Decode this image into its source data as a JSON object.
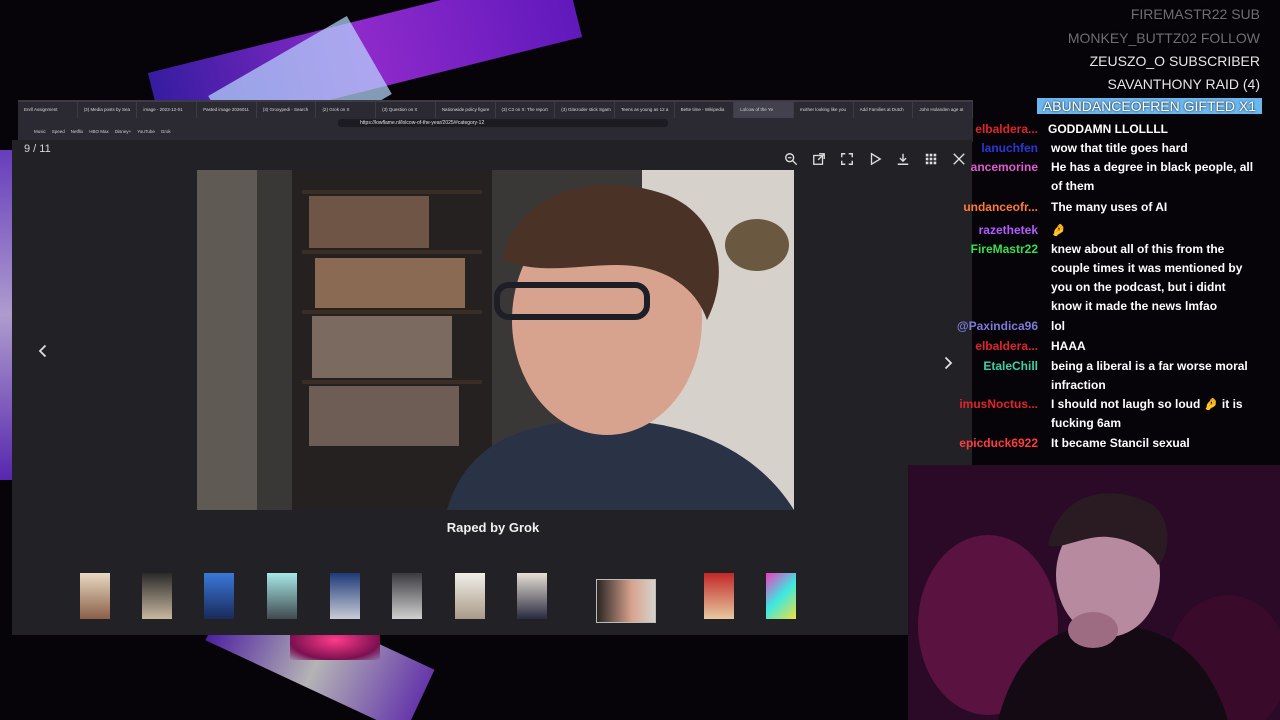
{
  "browser": {
    "tabs": [
      "Enrll Assignment",
      "(3) Media posts by Sea",
      "image - 2023-12-01",
      "Pasted image 2026011",
      "(3) Groxypedi - Search",
      "(2) Grok on X",
      "(3) Question on X",
      "Nationwide policy figure",
      "(3) C3 on X: The report",
      "(3) Gitezoder stick Sgam",
      "Teens as young as 12 a",
      "Bette time - Wikipedia",
      "Lolcow of the Ye",
      "mother looking like you",
      "Add Families at Dutch",
      "John Holanden age at"
    ],
    "url": "https://lowflame.nl/lolcow-of-the-year/2025/#category-12",
    "bookmarks": [
      "Music",
      "Speed",
      "Netflix",
      "HBO Max",
      "Disney+",
      "YouTube",
      "Grok"
    ]
  },
  "viewer": {
    "counter": "9 / 11",
    "caption": "Raped by Grok",
    "toolbar": [
      "zoom-icon",
      "open-external-icon",
      "fullscreen-icon",
      "slideshow-play-icon",
      "download-icon",
      "grid-icon",
      "close-icon"
    ]
  },
  "events": [
    {
      "user": "FIREMASTR22",
      "action": "SUB",
      "style": "dim"
    },
    {
      "user": "MONKEY_BUTTZ02",
      "action": "FOLLOW",
      "style": "dim"
    },
    {
      "user": "ZEUSZO_O",
      "action": "SUBSCRIBER",
      "style": "normal"
    },
    {
      "user": "SAVANTHONY",
      "action": "RAID (4)",
      "style": "normal"
    },
    {
      "user": "ABUNDANCEOFREN",
      "action": "GIFTED X1",
      "style": "highlight"
    }
  ],
  "chat": [
    {
      "user": "elbaldera...",
      "color": "#e0242c",
      "message": "GODDAMN LLOLLLL"
    },
    {
      "user": "lanuchfen",
      "color": "#2a36d8",
      "message": "wow that title goes hard"
    },
    {
      "user": "ancemorine",
      "color": "#e05bd0",
      "message": "He has a degree in black people, all of them"
    },
    {
      "user": "undanceofr...",
      "color": "#ff7a3a",
      "message": "The many uses of AI"
    },
    {
      "user": "razethetek",
      "color": "#b35cff",
      "message": "🤌"
    },
    {
      "user": "FireMastr22",
      "color": "#35e04a",
      "message": "knew about all of this from the couple times it was mentioned by you on the podcast, but i didnt know it made the news lmfao"
    },
    {
      "user": "@Paxindica96",
      "color": "#7d7ad8",
      "message": "lol"
    },
    {
      "user": "elbaldera...",
      "color": "#e0242c",
      "message": "HAAA"
    },
    {
      "user": "EtaleChill",
      "color": "#3fd0a0",
      "message": "being a liberal is a far worse moral infraction"
    },
    {
      "user": "imusNoctus...",
      "color": "#e0242c",
      "message": "I should not laugh so loud 🤌 it is fucking 6am"
    },
    {
      "user": "epicduck6922",
      "color": "#ff3c3c",
      "message": "It became Stancil sexual"
    }
  ]
}
